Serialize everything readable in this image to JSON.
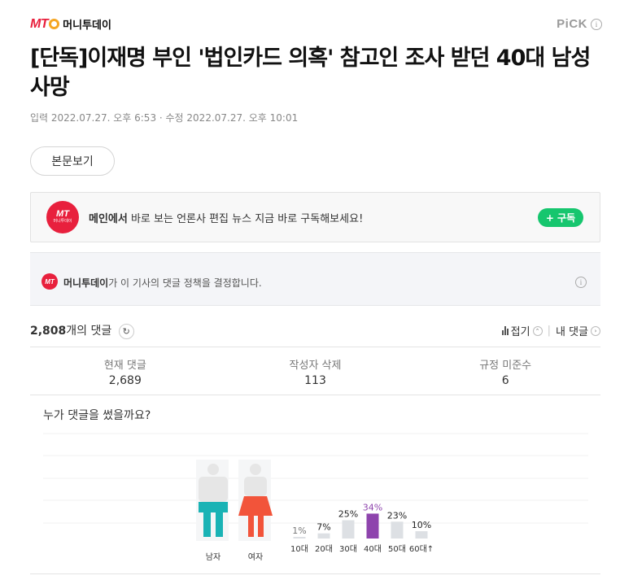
{
  "header": {
    "logo_mt": "MT",
    "logo_name": "머니투데이",
    "pick_label": "PiCK",
    "info_glyph": "i"
  },
  "article": {
    "title": "[단독]이재명 부인 '법인카드 의혹' 참고인 조사 받던 40대 남성 사망",
    "dates": "입력 2022.07.27. 오후 6:53 · 수정 2022.07.27. 오후 10:01",
    "read_button": "본문보기"
  },
  "subscribe": {
    "logo_main": "MT",
    "logo_sub": "머니투데이",
    "bold_text": "메인에서",
    "text": " 바로 보는 언론사 편집 뉴스 지금 바로 구독해보세요!",
    "button": "+ 구독"
  },
  "policy": {
    "logo": "MT",
    "press": "머니투데이",
    "text": "가 이 기사의 댓글 정책을 결정합니다."
  },
  "comments": {
    "count": "2,808",
    "count_suffix": "개의 댓글",
    "refresh_icon": "↻",
    "fold_label": "접기",
    "fold_icon": "⌃",
    "my_comments": "내 댓글",
    "my_icon": "›",
    "separator": "|"
  },
  "stats": [
    {
      "label": "현재 댓글",
      "value": "2,689"
    },
    {
      "label": "작성자 삭제",
      "value": "113"
    },
    {
      "label": "규정 미준수",
      "value": "6"
    }
  ],
  "colors": {
    "brand": "#e8203d",
    "subscribe": "#16c66e",
    "male": "#1ab3b5",
    "female": "#f2543a",
    "highlight": "#8e44ad",
    "bar": "#dde0e4"
  },
  "chart_data": {
    "type": "bar",
    "title": "누가 댓글을 썼을까요?",
    "gender": [
      {
        "label": "남자",
        "color": "#1ab3b5"
      },
      {
        "label": "여자",
        "color": "#f2543a"
      }
    ],
    "categories": [
      "10대",
      "20대",
      "30대",
      "40대",
      "50대",
      "60대↑"
    ],
    "values": [
      1,
      7,
      25,
      34,
      23,
      10
    ],
    "labels": [
      "1%",
      "7%",
      "25%",
      "34%",
      "23%",
      "10%"
    ],
    "highlight_index": 3,
    "ylim": [
      0,
      100
    ]
  }
}
